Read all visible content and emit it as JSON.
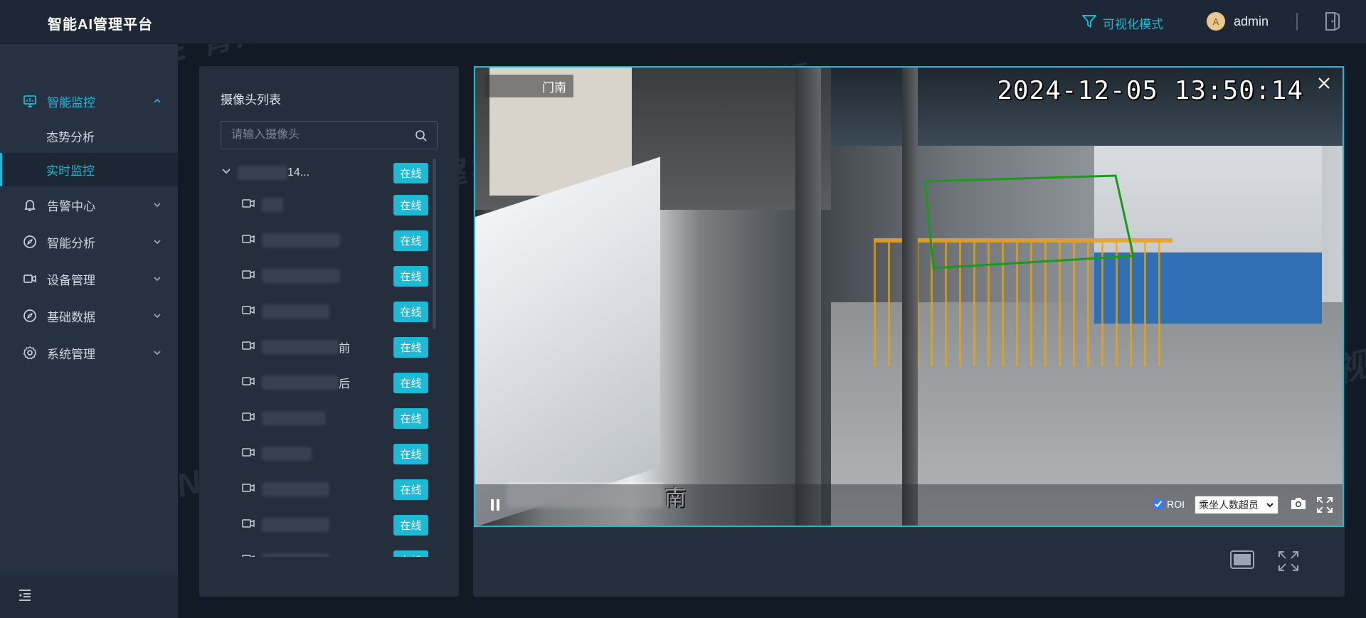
{
  "header": {
    "brand": "智能AI管理平台",
    "vis_mode_label": "可视化模式",
    "user": {
      "avatar_initial": "A",
      "name": "admin"
    }
  },
  "sidebar": {
    "items": [
      {
        "label": "智能监控",
        "icon": "monitor-icon",
        "open": true,
        "children": [
          {
            "label": "态势分析"
          },
          {
            "label": "实时监控",
            "active": true
          }
        ]
      },
      {
        "label": "告警中心",
        "icon": "bell-icon"
      },
      {
        "label": "智能分析",
        "icon": "compass-icon"
      },
      {
        "label": "设备管理",
        "icon": "video-camera-icon"
      },
      {
        "label": "基础数据",
        "icon": "compass-icon"
      },
      {
        "label": "系统管理",
        "icon": "gear-icon"
      }
    ]
  },
  "camera_list": {
    "title": "摄像头列表",
    "search_placeholder": "请输入摄像头",
    "group": {
      "name": "14...",
      "status": "在线"
    },
    "cameras": [
      {
        "name_suffix": "",
        "status": "在线"
      },
      {
        "name_suffix": "",
        "status": "在线"
      },
      {
        "name_suffix": "",
        "status": "在线"
      },
      {
        "name_suffix": "",
        "status": "在线"
      },
      {
        "name_suffix": "前",
        "status": "在线"
      },
      {
        "name_suffix": "后",
        "status": "在线"
      },
      {
        "name_suffix": "",
        "status": "在线"
      },
      {
        "name_suffix": "",
        "status": "在线"
      },
      {
        "name_suffix": "",
        "status": "在线"
      },
      {
        "name_suffix": "",
        "status": "在线"
      },
      {
        "name_suffix": "",
        "status": "在线"
      }
    ]
  },
  "video": {
    "camera_tag": "门南",
    "timestamp": "2024-12-05 13:50:14",
    "overlay_name_suffix": "南",
    "roi_label": "ROI",
    "roi_checked": true,
    "rule_selected": "乘坐人数超员"
  },
  "watermark_text": "TSINGSEE 青犀视频",
  "colors": {
    "accent": "#1fb9d6",
    "online_badge": "#1eb9d5",
    "roi_polygon": "#1a9a1a",
    "sidebar_bg": "#263142",
    "header_bg": "#1e2735"
  }
}
